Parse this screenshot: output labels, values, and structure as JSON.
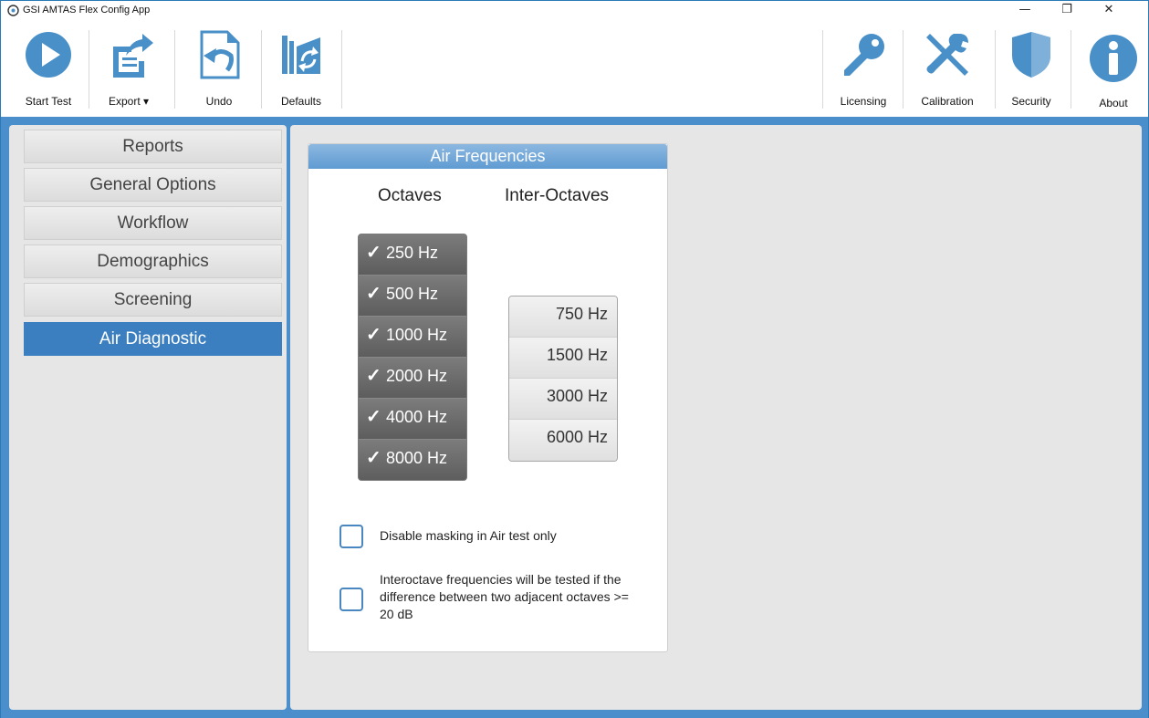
{
  "window": {
    "title": "GSI AMTAS Flex Config App",
    "minimize_glyph": "—",
    "restore_glyph": "❐",
    "close_glyph": "✕"
  },
  "toolbar": {
    "left": [
      {
        "label": "Start Test",
        "icon": "play-icon"
      },
      {
        "label": "Export ▾",
        "icon": "export-icon"
      },
      {
        "label": "Undo",
        "icon": "undo-icon"
      },
      {
        "label": "Defaults",
        "icon": "defaults-icon"
      }
    ],
    "right": [
      {
        "label": "Licensing",
        "icon": "key-icon"
      },
      {
        "label": "Calibration",
        "icon": "tools-icon"
      },
      {
        "label": "Security",
        "icon": "shield-icon"
      },
      {
        "label": "About",
        "icon": "info-icon"
      }
    ]
  },
  "sidebar": {
    "items": [
      {
        "label": "Reports",
        "active": false
      },
      {
        "label": "General Options",
        "active": false
      },
      {
        "label": "Workflow",
        "active": false
      },
      {
        "label": "Demographics",
        "active": false
      },
      {
        "label": "Screening",
        "active": false
      },
      {
        "label": "Air Diagnostic",
        "active": true
      }
    ]
  },
  "panel": {
    "title": "Air Frequencies",
    "octaves_header": "Octaves",
    "inter_octaves_header": "Inter-Octaves",
    "octaves": [
      {
        "label": "250 Hz",
        "checked": true
      },
      {
        "label": "500 Hz",
        "checked": true
      },
      {
        "label": "1000 Hz",
        "checked": true
      },
      {
        "label": "2000 Hz",
        "checked": true
      },
      {
        "label": "4000 Hz",
        "checked": true
      },
      {
        "label": "8000 Hz",
        "checked": true
      }
    ],
    "inter_octaves": [
      {
        "label": "750 Hz",
        "checked": false
      },
      {
        "label": "1500 Hz",
        "checked": false
      },
      {
        "label": "3000 Hz",
        "checked": false
      },
      {
        "label": "6000 Hz",
        "checked": false
      }
    ],
    "check_glyph": "✓",
    "options": [
      {
        "label": "Disable masking in Air test only",
        "checked": false
      },
      {
        "label": "Interoctave frequencies will be tested if the difference between two adjacent octaves >= 20 dB",
        "checked": false
      }
    ]
  },
  "colors": {
    "accent": "#3b7fc0",
    "icon_blue": "#4a90c8",
    "frame": "#4a8fcb"
  }
}
